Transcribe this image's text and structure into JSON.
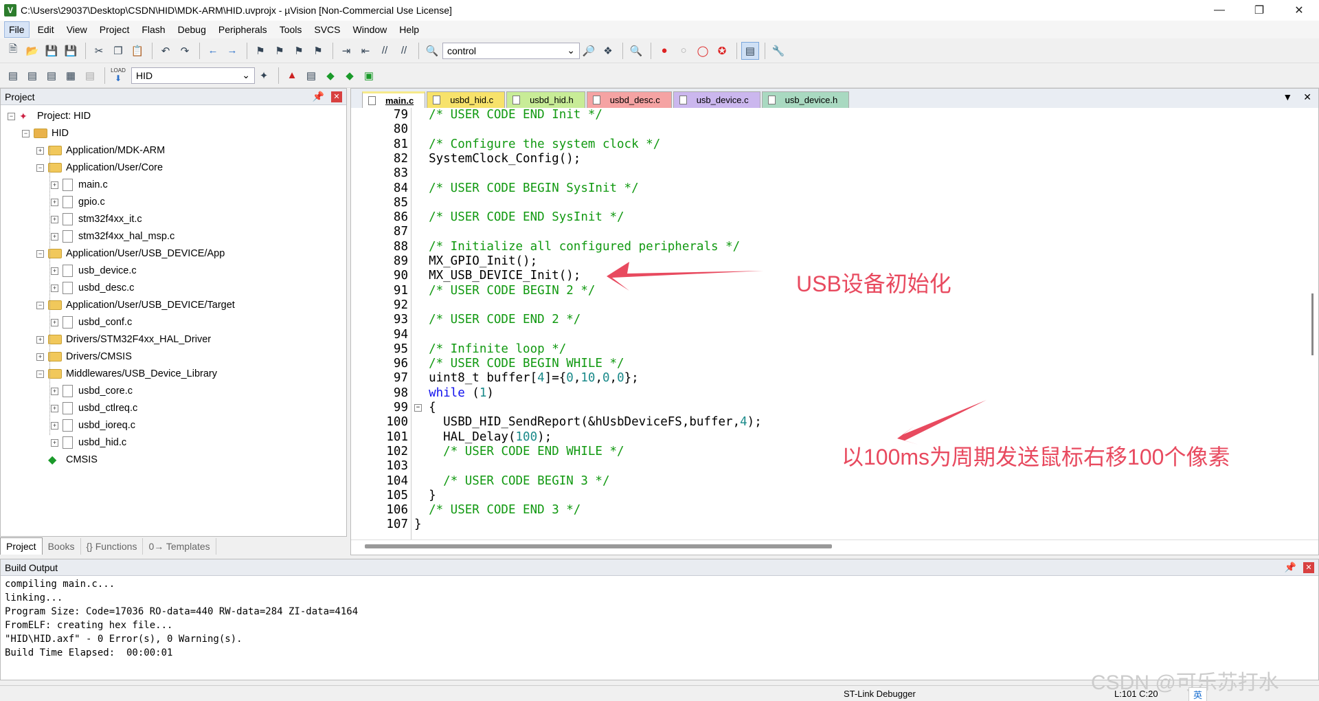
{
  "window": {
    "title": "C:\\Users\\29037\\Desktop\\CSDN\\HID\\MDK-ARM\\HID.uvprojx - µVision  [Non-Commercial Use License]",
    "app_icon": "V"
  },
  "menu": [
    "File",
    "Edit",
    "View",
    "Project",
    "Flash",
    "Debug",
    "Peripherals",
    "Tools",
    "SVCS",
    "Window",
    "Help"
  ],
  "toolbar1": {
    "search_combo": "control"
  },
  "toolbar2": {
    "target_combo": "HID",
    "load_label": "LOAD"
  },
  "project_panel": {
    "title": "Project",
    "tree": [
      {
        "label": "Project: HID",
        "level": 0,
        "type": "project",
        "exp": "-"
      },
      {
        "label": "HID",
        "level": 1,
        "type": "target",
        "exp": "-"
      },
      {
        "label": "Application/MDK-ARM",
        "level": 2,
        "type": "folder",
        "exp": "+"
      },
      {
        "label": "Application/User/Core",
        "level": 2,
        "type": "folder",
        "exp": "-"
      },
      {
        "label": "main.c",
        "level": 3,
        "type": "file",
        "exp": "+"
      },
      {
        "label": "gpio.c",
        "level": 3,
        "type": "file",
        "exp": "+"
      },
      {
        "label": "stm32f4xx_it.c",
        "level": 3,
        "type": "file",
        "exp": "+"
      },
      {
        "label": "stm32f4xx_hal_msp.c",
        "level": 3,
        "type": "file",
        "exp": "+"
      },
      {
        "label": "Application/User/USB_DEVICE/App",
        "level": 2,
        "type": "folder",
        "exp": "-"
      },
      {
        "label": "usb_device.c",
        "level": 3,
        "type": "file",
        "exp": "+"
      },
      {
        "label": "usbd_desc.c",
        "level": 3,
        "type": "file",
        "exp": "+"
      },
      {
        "label": "Application/User/USB_DEVICE/Target",
        "level": 2,
        "type": "folder",
        "exp": "-"
      },
      {
        "label": "usbd_conf.c",
        "level": 3,
        "type": "file",
        "exp": "+"
      },
      {
        "label": "Drivers/STM32F4xx_HAL_Driver",
        "level": 2,
        "type": "folder",
        "exp": "+"
      },
      {
        "label": "Drivers/CMSIS",
        "level": 2,
        "type": "folder",
        "exp": "+"
      },
      {
        "label": "Middlewares/USB_Device_Library",
        "level": 2,
        "type": "folder",
        "exp": "-"
      },
      {
        "label": "usbd_core.c",
        "level": 3,
        "type": "file",
        "exp": "+"
      },
      {
        "label": "usbd_ctlreq.c",
        "level": 3,
        "type": "file",
        "exp": "+"
      },
      {
        "label": "usbd_ioreq.c",
        "level": 3,
        "type": "file",
        "exp": "+"
      },
      {
        "label": "usbd_hid.c",
        "level": 3,
        "type": "file",
        "exp": "+"
      },
      {
        "label": "CMSIS",
        "level": 2,
        "type": "green",
        "exp": ""
      }
    ],
    "tabs": [
      "Project",
      "Books",
      "{} Functions",
      "0→ Templates"
    ]
  },
  "editor": {
    "tabs": [
      {
        "label": "main.c",
        "color": "#f6e98a",
        "active": true
      },
      {
        "label": "usbd_hid.c",
        "color": "#f7e26b"
      },
      {
        "label": "usbd_hid.h",
        "color": "#c8ec97"
      },
      {
        "label": "usbd_desc.c",
        "color": "#f5a3a3"
      },
      {
        "label": "usb_device.c",
        "color": "#cbb7ee"
      },
      {
        "label": "usb_device.h",
        "color": "#a9d9c1"
      }
    ],
    "lines": [
      {
        "n": "79",
        "t": "  /* USER CODE END Init */"
      },
      {
        "n": "80",
        "t": ""
      },
      {
        "n": "81",
        "t": "  /* Configure the system clock */"
      },
      {
        "n": "82",
        "t": "  SystemClock_Config();"
      },
      {
        "n": "83",
        "t": ""
      },
      {
        "n": "84",
        "t": "  /* USER CODE BEGIN SysInit */"
      },
      {
        "n": "85",
        "t": ""
      },
      {
        "n": "86",
        "t": "  /* USER CODE END SysInit */"
      },
      {
        "n": "87",
        "t": ""
      },
      {
        "n": "88",
        "t": "  /* Initialize all configured peripherals */"
      },
      {
        "n": "89",
        "t": "  MX_GPIO_Init();"
      },
      {
        "n": "90",
        "t": "  MX_USB_DEVICE_Init();"
      },
      {
        "n": "91",
        "t": "  /* USER CODE BEGIN 2 */"
      },
      {
        "n": "92",
        "t": ""
      },
      {
        "n": "93",
        "t": "  /* USER CODE END 2 */"
      },
      {
        "n": "94",
        "t": ""
      },
      {
        "n": "95",
        "t": "  /* Infinite loop */"
      },
      {
        "n": "96",
        "t": "  /* USER CODE BEGIN WHILE */"
      },
      {
        "n": "97",
        "t": "  uint8_t buffer[4]={0,10,0,0};"
      },
      {
        "n": "98",
        "t": "  while (1)"
      },
      {
        "n": "99",
        "t": "  {"
      },
      {
        "n": "100",
        "t": "    USBD_HID_SendReport(&hUsbDeviceFS,buffer,4);"
      },
      {
        "n": "101",
        "t": "    HAL_Delay(100);"
      },
      {
        "n": "102",
        "t": "    /* USER CODE END WHILE */"
      },
      {
        "n": "103",
        "t": ""
      },
      {
        "n": "104",
        "t": "    /* USER CODE BEGIN 3 */"
      },
      {
        "n": "105",
        "t": "  }"
      },
      {
        "n": "106",
        "t": "  /* USER CODE END 3 */"
      },
      {
        "n": "107",
        "t": "}"
      }
    ],
    "annotation1": "USB设备初始化",
    "annotation2": "以100ms为周期发送鼠标右移100个像素"
  },
  "build_output": {
    "title": "Build Output",
    "text": "compiling main.c...\nlinking...\nProgram Size: Code=17036 RO-data=440 RW-data=284 ZI-data=4164\nFromELF: creating hex file...\n\"HID\\HID.axf\" - 0 Error(s), 0 Warning(s).\nBuild Time Elapsed:  00:00:01"
  },
  "status": {
    "debugger": "ST-Link Debugger",
    "position": "L:101 C:20"
  },
  "watermark": "CSDN @可乐苏打水",
  "ime": "英"
}
